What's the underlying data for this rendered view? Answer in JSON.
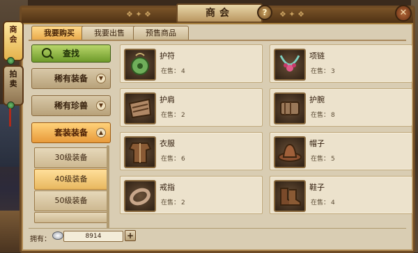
{
  "window": {
    "title": "商会",
    "help_icon": "?",
    "close_icon": "✕"
  },
  "side_tabs": [
    {
      "label": "商会",
      "icon": "lantern-icon"
    },
    {
      "label": "拍卖",
      "icon": "lantern-icon"
    }
  ],
  "tabs": [
    {
      "label": "我要购买",
      "active": true
    },
    {
      "label": "我要出售",
      "active": false
    },
    {
      "label": "预售商品",
      "active": false
    }
  ],
  "sidebar": {
    "search_label": "查找",
    "categories": [
      {
        "label": "稀有装备",
        "expanded": false
      },
      {
        "label": "稀有珍兽",
        "expanded": false
      },
      {
        "label": "套装装备",
        "expanded": true
      }
    ],
    "sub_items": [
      {
        "label": "30级装备",
        "selected": false
      },
      {
        "label": "40级装备",
        "selected": true
      },
      {
        "label": "50级装备",
        "selected": false
      }
    ]
  },
  "stock_label": "在售：",
  "items": [
    {
      "name": "护符",
      "stock": "4",
      "icon": "jade-amulet-icon"
    },
    {
      "name": "项链",
      "stock": "3",
      "icon": "necklace-icon"
    },
    {
      "name": "护肩",
      "stock": "2",
      "icon": "shoulder-guard-icon"
    },
    {
      "name": "护腕",
      "stock": "8",
      "icon": "bracer-icon"
    },
    {
      "name": "衣服",
      "stock": "6",
      "icon": "robe-icon"
    },
    {
      "name": "帽子",
      "stock": "5",
      "icon": "hat-icon"
    },
    {
      "name": "戒指",
      "stock": "2",
      "icon": "ring-icon"
    },
    {
      "name": "鞋子",
      "stock": "4",
      "icon": "boots-icon"
    }
  ],
  "footer": {
    "own_label": "拥有：",
    "currency_icon": "silver-ingot-icon",
    "amount": "8914",
    "add_label": "+"
  },
  "colors": {
    "accent_active": "#e8a848",
    "panel_bg": "#d9cdb3",
    "frame": "#6d4a24",
    "search_green": "#6e9a2a"
  }
}
